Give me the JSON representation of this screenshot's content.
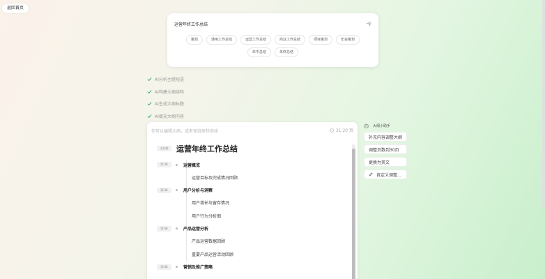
{
  "nav": {
    "back_label": "返回首页"
  },
  "search": {
    "value": "运营年终工作总结",
    "chips": [
      "策划",
      "通用工作总结",
      "运营工作总结",
      "商业工作总结",
      "项目策划",
      "年会策划",
      "年中总结",
      "年终总结"
    ]
  },
  "steps": [
    "AI分析主题短语",
    "AI构建大纲结构",
    "AI生成大纲标题",
    "AI填充大纲内容"
  ],
  "editor": {
    "hint": "你可以编辑大纲，或者保持原样继续",
    "meta": "31.20 页",
    "title_tag": "主标题",
    "title": "运营年终工作总结",
    "outline": [
      {
        "tag": "第1章",
        "chapter": "运营概览",
        "sections": [
          "运营目标及完成情况回顾"
        ]
      },
      {
        "tag": "第2章",
        "chapter": "用户分析与洞察",
        "sections": [
          "用户增长与留存情况",
          "用户行为分析图"
        ]
      },
      {
        "tag": "第3章",
        "chapter": "产品运营分析",
        "sections": [
          "产品运营数据回顾",
          "重要产品运营活动回顾"
        ]
      },
      {
        "tag": "第4章",
        "chapter": "营销及推广策略",
        "sections": []
      }
    ]
  },
  "assistant": {
    "title": "大纲小助手",
    "actions": [
      "补充内容调整大纲",
      "调整页数到30页",
      "更换为英文",
      "自定义调整..."
    ]
  },
  "colors": {
    "accent": "#1aa35c",
    "background_start": "#fbf2ea",
    "background_end": "#c8efcc"
  }
}
